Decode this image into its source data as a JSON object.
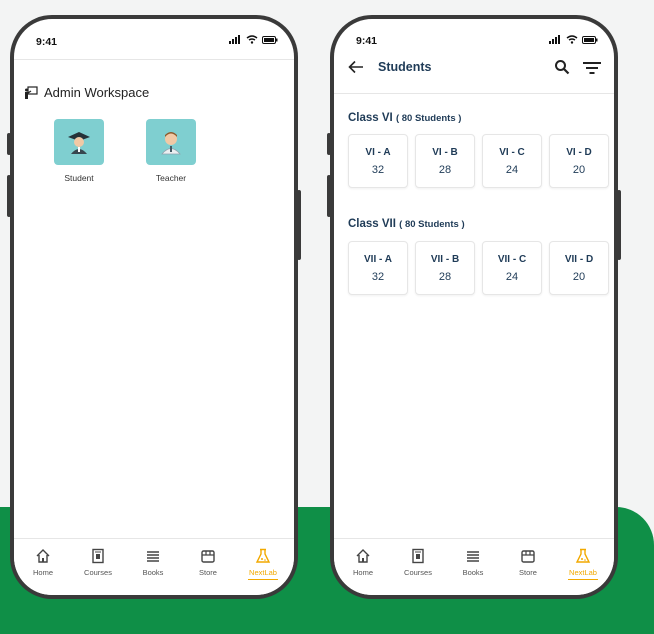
{
  "phone1": {
    "status_time": "9:41",
    "workspace_title": "Admin Workspace",
    "roles": [
      {
        "label": "Student",
        "icon": "graduate-student-icon"
      },
      {
        "label": "Teacher",
        "icon": "teacher-icon"
      }
    ]
  },
  "phone2": {
    "status_time": "9:41",
    "title": "Students",
    "classes": [
      {
        "name": "Class VI",
        "count": "( 80 Students )",
        "sections": [
          {
            "name": "VI - A",
            "count": "32"
          },
          {
            "name": "VI - B",
            "count": "28"
          },
          {
            "name": "VI - C",
            "count": "24"
          },
          {
            "name": "VI - D",
            "count": "20"
          }
        ]
      },
      {
        "name": "Class VII",
        "count": "( 80 Students )",
        "sections": [
          {
            "name": "VII - A",
            "count": "32"
          },
          {
            "name": "VII - B",
            "count": "28"
          },
          {
            "name": "VII - C",
            "count": "24"
          },
          {
            "name": "VII - D",
            "count": "20"
          }
        ]
      }
    ]
  },
  "tabbar": {
    "items": [
      {
        "label": "Home",
        "icon": "home-icon"
      },
      {
        "label": "Courses",
        "icon": "courses-icon"
      },
      {
        "label": "Books",
        "icon": "books-icon"
      },
      {
        "label": "Store",
        "icon": "store-icon"
      },
      {
        "label": "NextLab",
        "icon": "flask-icon"
      }
    ],
    "active": "NextLab",
    "active_color": "#f2a900"
  },
  "colors": {
    "background_green": "#0f8f47",
    "tile": "#7fcfd0",
    "heading": "#1f3b57"
  }
}
